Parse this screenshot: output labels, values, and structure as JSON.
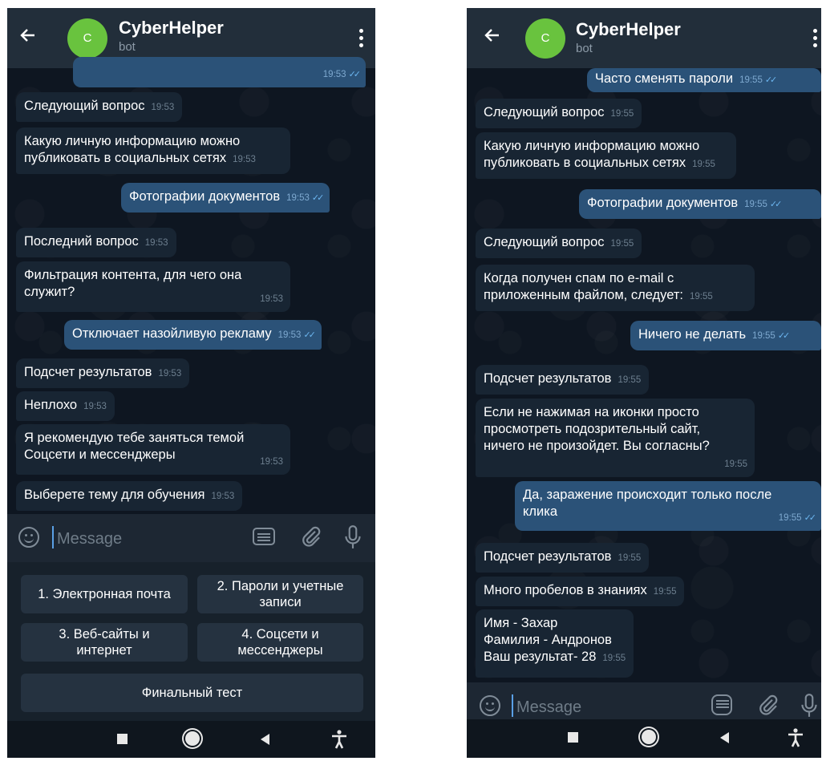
{
  "left": {
    "header": {
      "back_icon": "arrow-left-icon",
      "avatar_letter": "C",
      "title": "CyberHelper",
      "subtitle": "bot",
      "menu_icon": "more-vert-icon"
    },
    "messages": [
      {
        "dir": "out",
        "text": "",
        "time": "19:53",
        "read": true
      },
      {
        "dir": "in",
        "text": "Следующий вопрос",
        "time": "19:53"
      },
      {
        "dir": "in",
        "text": "Какую личную информацию можно\nпубликовать в социальных сетях",
        "time": "19:53"
      },
      {
        "dir": "out",
        "text": "Фотографии документов",
        "time": "19:53",
        "read": true
      },
      {
        "dir": "in",
        "text": "Последний вопрос",
        "time": "19:53"
      },
      {
        "dir": "in",
        "text": "Фильтрация контента, для чего она\nслужит?",
        "time": "19:53"
      },
      {
        "dir": "out",
        "text": "Отключает назойливую рекламу",
        "time": "19:53",
        "read": true
      },
      {
        "dir": "in",
        "text": "Подсчет результатов",
        "time": "19:53"
      },
      {
        "dir": "in",
        "text": "Неплохо",
        "time": "19:53"
      },
      {
        "dir": "in",
        "text": "Я рекомендую тебе заняться темой\nСоцсети и мессенджеры",
        "time": "19:53"
      },
      {
        "dir": "in",
        "text": "Выберете тему для обучения",
        "time": "19:53"
      }
    ],
    "input": {
      "placeholder": "Message"
    },
    "keyboard": [
      "1. Электронная почта",
      "2. Пароли и учетные\nзаписи",
      "3. Веб-сайты и\nинтернет",
      "4. Соцсети и\nмессенджеры",
      "Финальный тест"
    ]
  },
  "right": {
    "header": {
      "back_icon": "arrow-left-icon",
      "avatar_letter": "C",
      "title": "CyberHelper",
      "subtitle": "bot",
      "menu_icon": "more-vert-icon"
    },
    "messages": [
      {
        "dir": "out",
        "text": "Часто сменять пароли",
        "time": "19:55",
        "read": true
      },
      {
        "dir": "in",
        "text": "Следующий вопрос",
        "time": "19:55"
      },
      {
        "dir": "in",
        "text": "Какую личную информацию можно\nпубликовать в социальных сетях",
        "time": "19:55"
      },
      {
        "dir": "out",
        "text": "Фотографии документов",
        "time": "19:55",
        "read": true
      },
      {
        "dir": "in",
        "text": "Следующий вопрос",
        "time": "19:55"
      },
      {
        "dir": "in",
        "text": "Когда получен спам по e-mail с\nприложенным файлом, следует:",
        "time": "19:55"
      },
      {
        "dir": "out",
        "text": "Ничего не делать",
        "time": "19:55",
        "read": true
      },
      {
        "dir": "in",
        "text": "Подсчет результатов",
        "time": "19:55"
      },
      {
        "dir": "in",
        "text": "Если не нажимая на иконки просто\nпросмотреть подозрительный сайт,\nничего не произойдет. Вы согласны?",
        "time": "19:55"
      },
      {
        "dir": "out",
        "text": "Да, заражение происходит только после\nклика",
        "time": "19:55",
        "read": true
      },
      {
        "dir": "in",
        "text": "Подсчет результатов",
        "time": "19:55"
      },
      {
        "dir": "in",
        "text": "Много пробелов в знаниях",
        "time": "19:55"
      },
      {
        "dir": "in",
        "text": "Имя - Захар\nФамилия - Андронов\nВаш результат- 28",
        "time": "19:55"
      }
    ],
    "input": {
      "placeholder": "Message"
    }
  },
  "colors": {
    "header": "#222e3a",
    "chat_bg": "#0e1621",
    "incoming": "#182533",
    "outgoing": "#2b5278",
    "avatar": "#69c33e",
    "accent": "#5aa0e6"
  },
  "nav_icons": [
    "stop-square-icon",
    "home-circle-icon",
    "back-triangle-icon",
    "accessibility-icon"
  ]
}
